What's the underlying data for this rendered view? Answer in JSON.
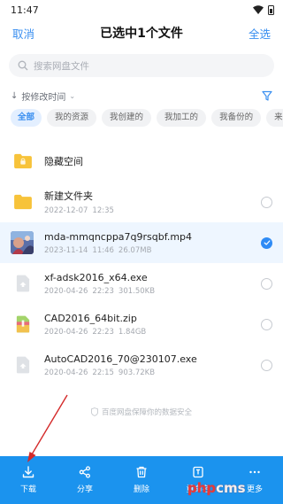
{
  "status": {
    "time": "11:47"
  },
  "header": {
    "left": "取消",
    "title": "已选中1个文件",
    "right": "全选"
  },
  "search": {
    "placeholder": "搜索网盘文件"
  },
  "sort": {
    "label": "按修改时间"
  },
  "chips": [
    "全部",
    "我的资源",
    "我创建的",
    "我加工的",
    "我备份的",
    "来自"
  ],
  "files": [
    {
      "name": "隐藏空间",
      "date": "",
      "time": "",
      "size": "",
      "icon": "lock-folder-icon",
      "selected": false,
      "selectable": false
    },
    {
      "name": "新建文件夹",
      "date": "2022-12-07",
      "time": "12:35",
      "size": "",
      "icon": "folder-icon",
      "selected": false,
      "selectable": true
    },
    {
      "name": "mda-mmqncppa7q9rsqbf.mp4",
      "date": "2023-11-14",
      "time": "11:46",
      "size": "26.07MB",
      "icon": "video-thumbnail",
      "selected": true,
      "selectable": true
    },
    {
      "name": "xf-adsk2016_x64.exe",
      "date": "2020-04-26",
      "time": "22:23",
      "size": "301.50KB",
      "icon": "exe-file-icon",
      "selected": false,
      "selectable": true
    },
    {
      "name": "CAD2016_64bit.zip",
      "date": "2020-04-26",
      "time": "22:23",
      "size": "1.84GB",
      "icon": "zip-file-icon",
      "selected": false,
      "selectable": true
    },
    {
      "name": "AutoCAD2016_70@230107.exe",
      "date": "2020-04-26",
      "time": "22:15",
      "size": "903.72KB",
      "icon": "exe-file-icon",
      "selected": false,
      "selectable": true
    }
  ],
  "notice": "百度网盘保障你的数据安全",
  "actions": [
    {
      "label": "下载",
      "icon": "download-icon"
    },
    {
      "label": "分享",
      "icon": "share-icon"
    },
    {
      "label": "删除",
      "icon": "delete-icon"
    },
    {
      "label": "重命名",
      "icon": "rename-icon"
    },
    {
      "label": "更多",
      "icon": "more-icon"
    }
  ],
  "watermark": {
    "a": "php",
    "b": "cms"
  },
  "colors": {
    "accent": "#3a8ff0",
    "bottom_bar": "#1b93ee",
    "folder": "#f7c33a",
    "annotation": "#d42a2a"
  }
}
